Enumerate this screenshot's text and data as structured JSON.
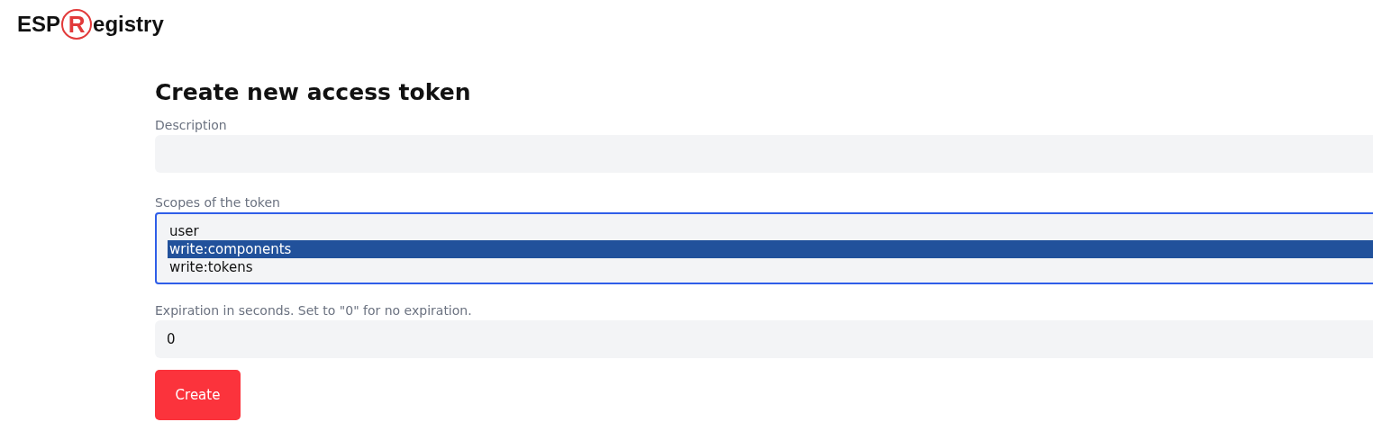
{
  "logo": {
    "prefix": "ESP",
    "letter": "R",
    "suffix": "egistry"
  },
  "title": "Create new access token",
  "description": {
    "label": "Description"
  },
  "scopes": {
    "label": "Scopes of the token",
    "focused": true,
    "options": [
      {
        "label": "user",
        "selected": false
      },
      {
        "label": "write:components",
        "selected": true
      },
      {
        "label": "write:tokens",
        "selected": false
      }
    ]
  },
  "expiration": {
    "label": "Expiration in seconds. Set to \"0\" for no expiration.",
    "value": "0"
  },
  "submit": "Create"
}
